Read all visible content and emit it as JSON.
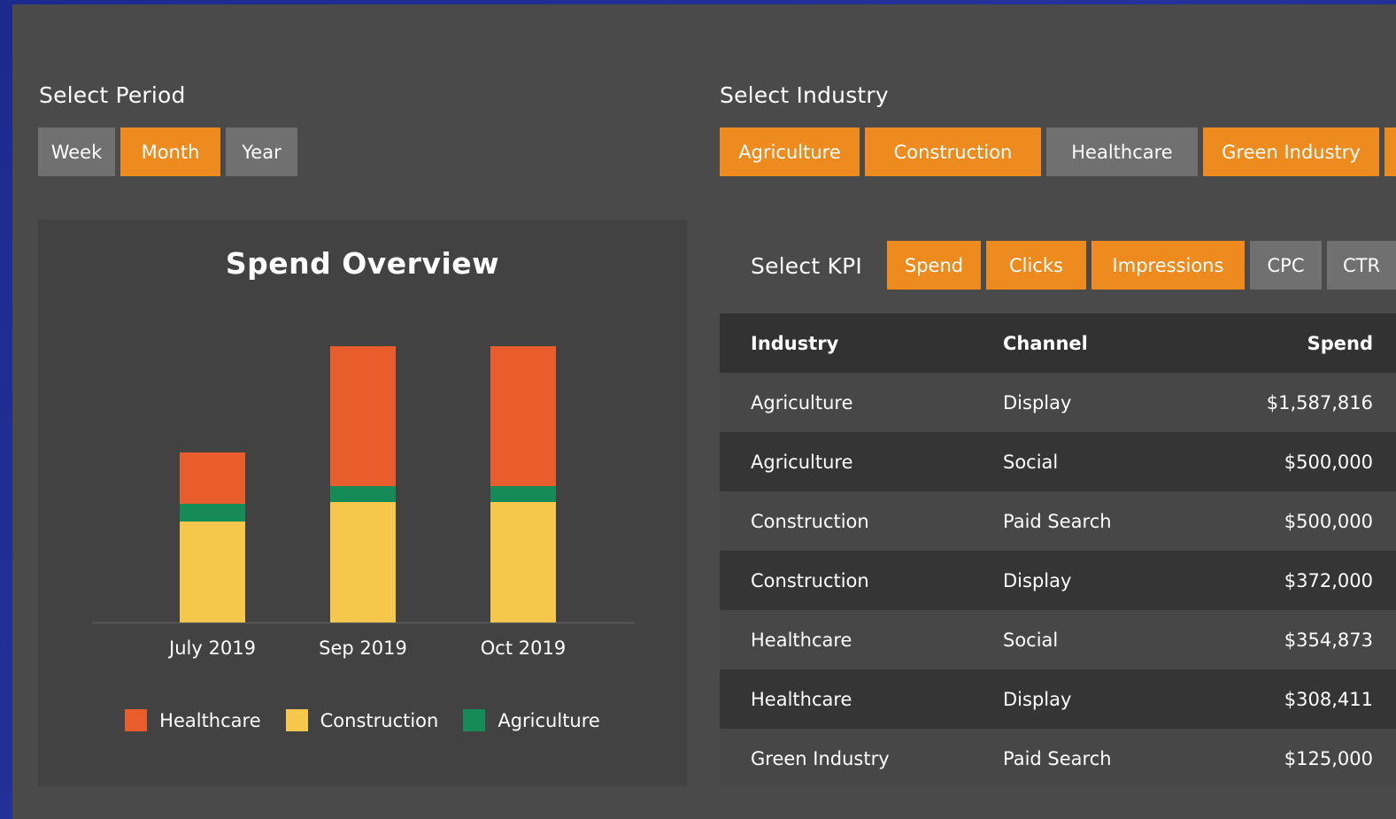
{
  "period": {
    "label": "Select Period",
    "options": [
      {
        "label": "Week",
        "active": false
      },
      {
        "label": "Month",
        "active": true
      },
      {
        "label": "Year",
        "active": false
      }
    ]
  },
  "industry": {
    "label": "Select Industry",
    "options": [
      {
        "label": "Agriculture",
        "active": true
      },
      {
        "label": "Construction",
        "active": true
      },
      {
        "label": "Healthcare",
        "active": false
      },
      {
        "label": "Green Industry",
        "active": true
      }
    ]
  },
  "kpi": {
    "label": "Select KPI",
    "options": [
      {
        "label": "Spend",
        "active": true
      },
      {
        "label": "Clicks",
        "active": true
      },
      {
        "label": "Impressions",
        "active": true
      },
      {
        "label": "CPC",
        "active": false
      },
      {
        "label": "CTR",
        "active": false
      }
    ]
  },
  "table": {
    "columns": [
      "Industry",
      "Channel",
      "Spend"
    ],
    "rows": [
      [
        "Agriculture",
        "Display",
        "$1,587,816"
      ],
      [
        "Agriculture",
        "Social",
        "$500,000"
      ],
      [
        "Construction",
        "Paid Search",
        "$500,000"
      ],
      [
        "Construction",
        "Display",
        "$372,000"
      ],
      [
        "Healthcare",
        "Social",
        "$354,873"
      ],
      [
        "Healthcare",
        "Display",
        "$308,411"
      ],
      [
        "Green Industry",
        "Paid Search",
        "$125,000"
      ]
    ]
  },
  "colors": {
    "accent": "#ed8b1e",
    "inactive": "#707070",
    "healthcare": "#e95d2d",
    "construction": "#f5c74a",
    "agriculture": "#168a57"
  },
  "chart_data": {
    "type": "bar",
    "stacked": true,
    "title": "Spend Overview",
    "categories": [
      "July 2019",
      "Sep 2019",
      "Oct 2019"
    ],
    "series": [
      {
        "name": "Agriculture",
        "color": "#168a57",
        "values": [
          20,
          18,
          18
        ]
      },
      {
        "name": "Construction",
        "color": "#f5c74a",
        "values": [
          114,
          136,
          136
        ]
      },
      {
        "name": "Healthcare",
        "color": "#e95d2d",
        "values": [
          58,
          158,
          158
        ]
      }
    ],
    "stack_order": [
      "Construction",
      "Agriculture",
      "Healthcare"
    ],
    "legend": [
      "Healthcare",
      "Construction",
      "Agriculture"
    ],
    "legend_position": "bottom",
    "ylim": [
      0,
      320
    ],
    "grid": false
  }
}
